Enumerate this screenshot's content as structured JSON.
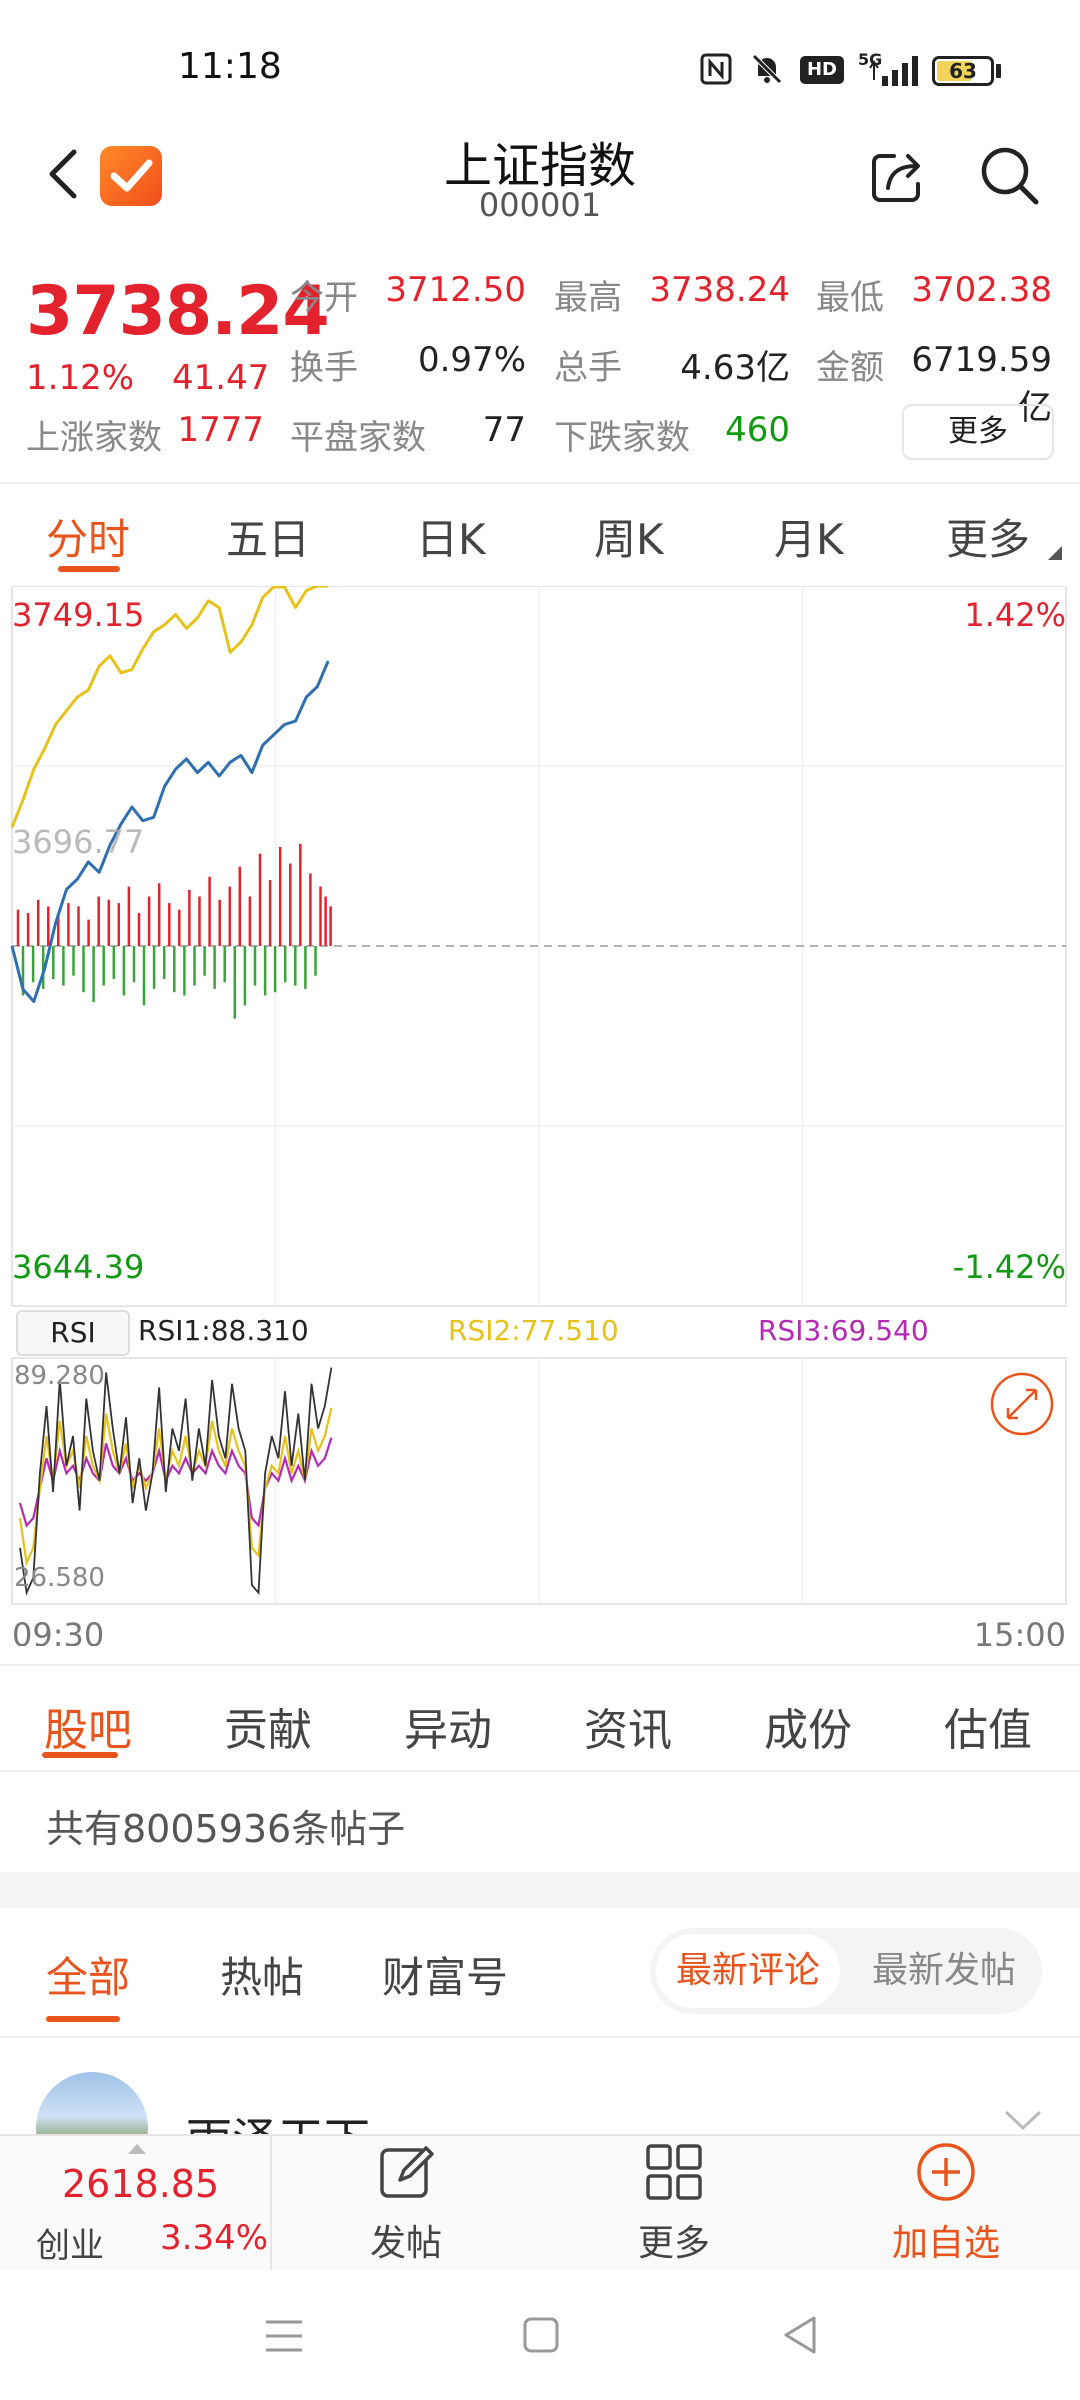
{
  "status_bar": {
    "time": "11:18",
    "network": "5G",
    "hd": "HD",
    "battery": "63"
  },
  "header": {
    "title": "上证指数",
    "code": "000001"
  },
  "quote": {
    "price": "3738.24",
    "change_pct": "1.12%",
    "change_val": "41.47",
    "fields": [
      {
        "label": "今开",
        "value": "3712.50",
        "color": "#e2222c"
      },
      {
        "label": "最高",
        "value": "3738.24",
        "color": "#e2222c"
      },
      {
        "label": "最低",
        "value": "3702.38",
        "color": "#e2222c"
      },
      {
        "label": "换手",
        "value": "0.97%",
        "color": "#222222"
      },
      {
        "label": "总手",
        "value": "4.63亿",
        "color": "#222222"
      },
      {
        "label": "金额",
        "value": "6719.59亿",
        "color": "#222222"
      }
    ],
    "breadth": [
      {
        "label": "上涨家数",
        "value": "1777",
        "color": "#e2222c"
      },
      {
        "label": "平盘家数",
        "value": "77",
        "color": "#222222"
      },
      {
        "label": "下跌家数",
        "value": "460",
        "color": "#119911"
      }
    ],
    "more_label": "更多"
  },
  "period_tabs": [
    "分时",
    "五日",
    "日K",
    "周K",
    "月K",
    "更多"
  ],
  "chart_data": {
    "type": "line",
    "title": "",
    "y_max_label": "3749.15",
    "y_min_label": "3644.39",
    "y_mid_label": "3696.77",
    "pct_max_label": "1.42%",
    "pct_min_label": "-1.42%",
    "ylim": [
      3644.39,
      3749.15
    ],
    "xlabels": [
      "09:30",
      "15:00"
    ],
    "series": [
      {
        "color": "#2f6faf",
        "values": [
          3696.77,
          3690.5,
          3688.7,
          3693.5,
          3700.1,
          3705.0,
          3706.5,
          3709.0,
          3707.5,
          3711.5,
          3714.5,
          3717.0,
          3715.0,
          3715.5,
          3720.0,
          3722.5,
          3724.0,
          3722.0,
          3723.5,
          3721.5,
          3723.5,
          3724.5,
          3722.0,
          3726.0,
          3727.5,
          3729.0,
          3729.5,
          3733.0,
          3734.5,
          3738.24
        ]
      },
      {
        "color": "#e6c21a",
        "values": [
          3714.0,
          3718.0,
          3722.5,
          3725.5,
          3729.0,
          3731.0,
          3733.0,
          3734.0,
          3737.5,
          3739.0,
          3736.5,
          3737.0,
          3740.0,
          3742.5,
          3743.5,
          3745.0,
          3743.0,
          3744.5,
          3747.0,
          3746.0,
          3739.5,
          3741.0,
          3743.5,
          3747.5,
          3749.0,
          3749.0,
          3746.0,
          3748.5,
          3749.15,
          3749.15
        ]
      }
    ],
    "volume_bars": [
      22,
      -30,
      20,
      -22,
      28,
      -26,
      24,
      -20,
      18,
      -24,
      26,
      -18,
      24,
      -28,
      16,
      -34,
      30,
      -24,
      28,
      -20,
      26,
      -30,
      36,
      -22,
      20,
      -36,
      30,
      -26,
      38,
      -20,
      26,
      -28,
      22,
      -30,
      34,
      -24,
      30,
      -18,
      42,
      -26,
      28,
      -22,
      36,
      -44,
      48,
      -36,
      30,
      -24,
      56,
      -30,
      40,
      -28,
      60,
      -22,
      50,
      -24,
      62,
      -26,
      44,
      -18,
      36,
      30,
      24
    ],
    "rsi": {
      "labels": {
        "box": "RSI",
        "r1": "RSI1:88.310",
        "r2": "RSI2:77.510",
        "r3": "RSI3:69.540"
      },
      "colors": {
        "r1": "#333333",
        "r2": "#e6c21a",
        "r3": "#b42ab4"
      },
      "max_label": "89.280",
      "min_label": "26.580",
      "ylim": [
        26.58,
        89.28
      ],
      "r1": [
        40,
        28,
        32,
        60,
        78,
        55,
        85,
        62,
        70,
        50,
        80,
        66,
        58,
        87,
        72,
        60,
        75,
        52,
        64,
        50,
        60,
        83,
        55,
        72,
        66,
        80,
        58,
        72,
        62,
        85,
        70,
        64,
        84,
        72,
        66,
        30,
        28,
        60,
        70,
        64,
        82,
        62,
        76,
        58,
        84,
        72,
        78,
        88.31
      ],
      "r2": [
        48,
        36,
        40,
        56,
        70,
        58,
        74,
        62,
        66,
        56,
        70,
        62,
        58,
        76,
        66,
        60,
        68,
        56,
        62,
        56,
        60,
        72,
        58,
        66,
        62,
        70,
        60,
        66,
        62,
        74,
        66,
        62,
        72,
        66,
        62,
        40,
        38,
        56,
        62,
        60,
        70,
        60,
        66,
        58,
        72,
        66,
        70,
        77.51
      ],
      "r3": [
        52,
        46,
        48,
        56,
        64,
        58,
        66,
        60,
        62,
        58,
        64,
        60,
        58,
        68,
        62,
        60,
        64,
        58,
        60,
        58,
        60,
        66,
        58,
        62,
        60,
        64,
        60,
        62,
        60,
        66,
        62,
        60,
        66,
        62,
        60,
        48,
        46,
        56,
        60,
        58,
        64,
        58,
        62,
        58,
        66,
        62,
        64,
        69.54
      ]
    }
  },
  "content_tabs": [
    "股吧",
    "贡献",
    "异动",
    "资讯",
    "成份",
    "估值"
  ],
  "post_count": "共有8005936条帖子",
  "forum_tabs": [
    "全部",
    "热帖",
    "财富号"
  ],
  "sort_options": [
    "最新评论",
    "最新发帖"
  ],
  "first_post": {
    "author": "雨泽天下"
  },
  "bottom_bar": {
    "index_value": "2618.85",
    "index_name": "创业",
    "index_pct": "3.34%",
    "actions": [
      "发帖",
      "更多",
      "加自选"
    ]
  }
}
